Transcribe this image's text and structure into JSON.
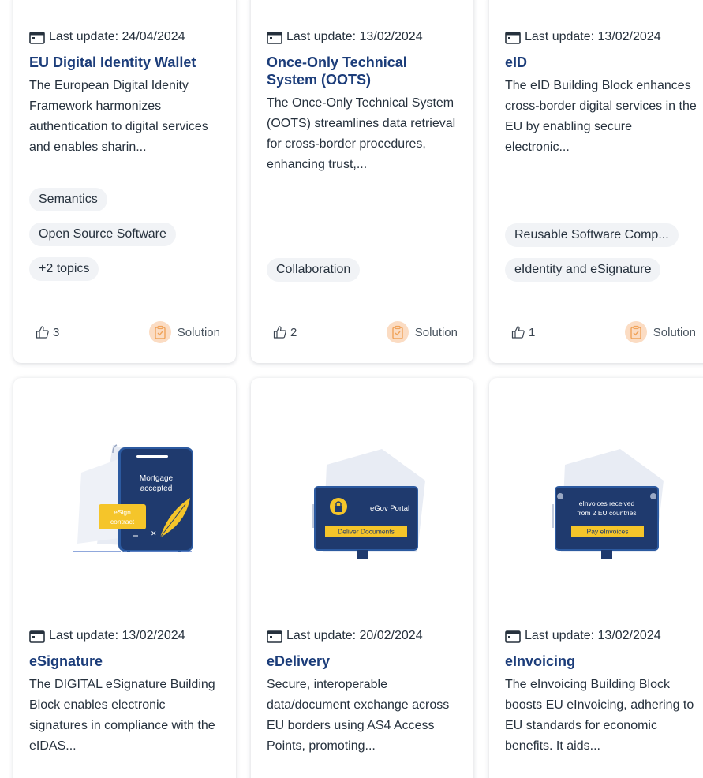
{
  "row1": [
    {
      "date": "Last update: 24/04/2024",
      "title": "EU Digital Identity Wallet",
      "description": "The European Digital Idenity Framework harmonizes authentication to digital services and enables sharin...",
      "tags": [
        "Semantics",
        "Open Source Software",
        "+2 topics"
      ],
      "likes": "3",
      "type": "Solution"
    },
    {
      "date": "Last update: 13/02/2024",
      "title": "Once-Only Technical System (OOTS)",
      "description": "The Once-Only Technical System (OOTS) streamlines data retrieval for cross-border procedures, enhancing trust,...",
      "tags": [
        "Collaboration"
      ],
      "likes": "2",
      "type": "Solution"
    },
    {
      "date": "Last update: 13/02/2024",
      "title": "eID",
      "description": "The eID Building Block enhances cross-border digital services in the EU by enabling secure electronic...",
      "tags": [
        "Reusable Software Comp...",
        "eIdentity and eSignature"
      ],
      "likes": "1",
      "type": "Solution"
    }
  ],
  "row2": [
    {
      "date": "Last update: 13/02/2024",
      "title": "eSignature",
      "description": "The DIGITAL eSignature Building Block enables electronic signatures in compliance with the eIDAS...",
      "illustration": {
        "screen_text": "Mortgage accepted",
        "badge_text": "eSign contract"
      }
    },
    {
      "date": "Last update: 20/02/2024",
      "title": "eDelivery",
      "description": "Secure, interoperable data/document exchange across EU borders using AS4 Access Points, promoting...",
      "illustration": {
        "screen_text": "eGov Portal",
        "button_text": "Deliver Documents"
      }
    },
    {
      "date": "Last update: 13/02/2024",
      "title": "eInvoicing",
      "description": "The eInvoicing Building Block boosts EU eInvoicing, adhering to EU standards for economic benefits. It aids...",
      "illustration": {
        "screen_text": "eInvoices received from 2 EU countries",
        "button_text": "Pay eInvoices"
      }
    }
  ],
  "colors": {
    "title": "#1c3d7a",
    "tag_bg": "#f1f3f6",
    "solution_icon_bg": "#fbdcc3",
    "solution_icon": "#f0a35a",
    "illus_dark": "#1f3a6e",
    "illus_accent": "#f5c52a",
    "illus_bg": "#e8ecf4"
  },
  "icons": {
    "calendar": "calendar-icon",
    "like": "thumbs-up-icon",
    "solution": "clipboard-check-icon"
  }
}
